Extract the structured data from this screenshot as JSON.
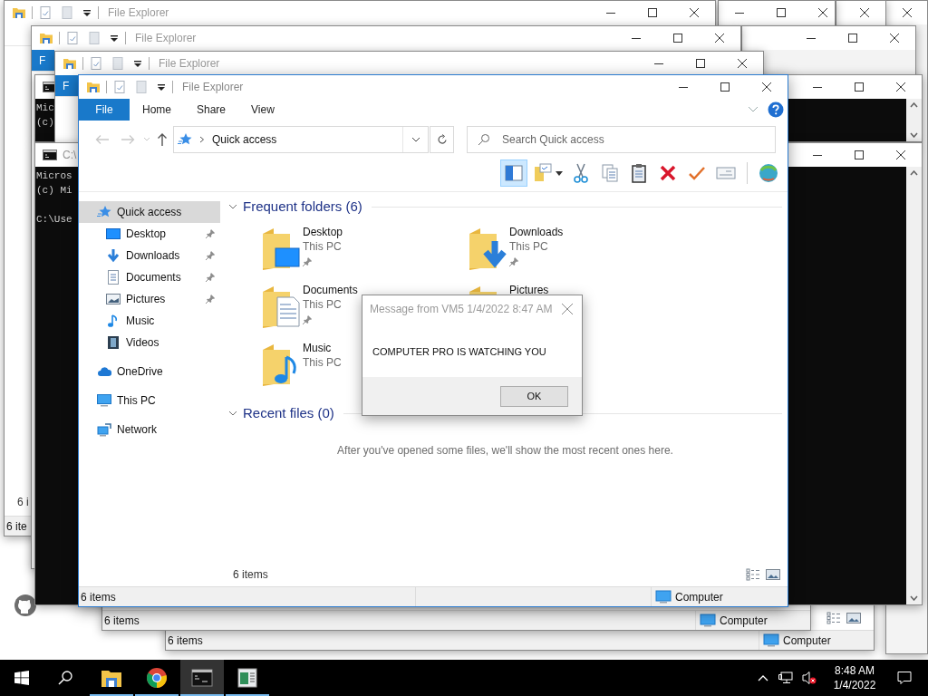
{
  "background_windows": [
    {
      "kind": "blank"
    },
    {
      "kind": "blank"
    },
    {
      "kind": "blank"
    },
    {
      "kind": "blank"
    },
    {
      "kind": "explorer",
      "title": "File Explorer",
      "item_count": "6 i",
      "status": "6 ite"
    },
    {
      "kind": "explorer",
      "title": "File Explorer",
      "file_tab": "F"
    },
    {
      "kind": "explorer",
      "status": "6 items",
      "location": "Computer"
    },
    {
      "kind": "explorer",
      "status": "6 items",
      "location": "Computer"
    },
    {
      "kind": "console",
      "paragraphs": [
        [
          "Mic",
          "(c)"
        ]
      ]
    },
    {
      "kind": "explorer",
      "title": "File Explorer",
      "file_tab": "F"
    },
    {
      "kind": "console",
      "title": "C:\\",
      "paragraphs": [
        [
          "Micros",
          "(c) Mi"
        ],
        [
          "C:\\Use"
        ]
      ]
    }
  ],
  "explorer": {
    "title": "File Explorer",
    "tabs": [
      {
        "label": "File",
        "kind": "file"
      },
      {
        "label": "Home",
        "kind": "tab"
      },
      {
        "label": "Share",
        "kind": "tab"
      },
      {
        "label": "View",
        "kind": "tab"
      }
    ],
    "address": "Quick access",
    "search": {
      "placeholder": "Search Quick access"
    },
    "toolbar": [
      {
        "kind": "pane",
        "selected": true
      },
      {
        "kind": "folder_note",
        "selected": false
      },
      {
        "kind": "cut",
        "selected": false
      },
      {
        "kind": "copy",
        "selected": false
      },
      {
        "kind": "paste",
        "selected": false
      },
      {
        "kind": "delete",
        "selected": false
      },
      {
        "kind": "check",
        "selected": false
      },
      {
        "kind": "card",
        "selected": false
      },
      {
        "kind": "globe",
        "selected": false
      }
    ],
    "sidebar": {
      "items": [
        {
          "label": "Quick access",
          "kind": "star",
          "selected": true,
          "children": [
            {
              "label": "Desktop",
              "kind": "desktop",
              "pinned": true,
              "selected": false
            },
            {
              "label": "Downloads",
              "kind": "downloads",
              "pinned": true,
              "selected": false
            },
            {
              "label": "Documents",
              "kind": "documents",
              "pinned": true,
              "selected": false
            },
            {
              "label": "Pictures",
              "kind": "pictures",
              "pinned": true,
              "selected": false
            },
            {
              "label": "Music",
              "kind": "music",
              "pinned": false,
              "selected": false
            },
            {
              "label": "Videos",
              "kind": "videos",
              "pinned": false,
              "selected": false
            }
          ]
        },
        {
          "label": "OneDrive",
          "kind": "cloud",
          "selected": false
        },
        {
          "label": "This PC",
          "kind": "pc",
          "selected": false
        },
        {
          "label": "Network",
          "kind": "network",
          "selected": false
        }
      ]
    },
    "frequent": {
      "heading": "Frequent folders (6)",
      "expanded": true,
      "folders": [
        {
          "name": "Desktop",
          "location": "This PC",
          "pinned": true,
          "kind": "desktop"
        },
        {
          "name": "Downloads",
          "location": "This PC",
          "pinned": true,
          "kind": "downloads"
        },
        {
          "name": "Documents",
          "location": "This PC",
          "pinned": true,
          "kind": "documents"
        },
        {
          "name": "Pictures",
          "kind": "pictures"
        },
        {
          "name": "Music",
          "location": "This PC",
          "pinned": false,
          "kind": "music"
        }
      ]
    },
    "recent": {
      "heading": "Recent files (0)",
      "expanded": true,
      "message": "After you've opened some files, we'll show the most recent ones here."
    },
    "item_count": "6 items",
    "status_bar": {
      "items": "6 items",
      "location": "Computer"
    }
  },
  "dialog": {
    "title": "Message from VM5 1/4/2022 8:47 AM",
    "message": "COMPUTER PRO IS WATCHING YOU",
    "button": "OK"
  },
  "taskbar": {
    "apps": [
      {
        "kind": "explorer",
        "running": true,
        "selected": false
      },
      {
        "kind": "browser",
        "running": true,
        "selected": false
      },
      {
        "kind": "console",
        "running": true,
        "selected": true
      },
      {
        "kind": "document",
        "running": true,
        "selected": false
      }
    ],
    "volume_muted": true,
    "time": "8:48 AM",
    "date": "1/4/2022"
  }
}
